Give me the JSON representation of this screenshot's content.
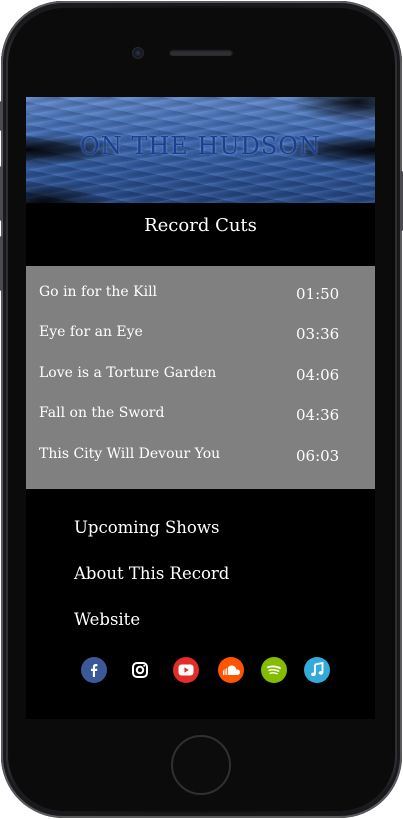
{
  "banner": {
    "title": "ON THE HUDSON"
  },
  "page": {
    "section_title": "Record Cuts"
  },
  "tracks": [
    {
      "title": "Go in for the Kill",
      "duration": "01:50"
    },
    {
      "title": "Eye for an Eye",
      "duration": "03:36"
    },
    {
      "title": "Love is a Torture Garden",
      "duration": "04:06"
    },
    {
      "title": "Fall on the Sword",
      "duration": "04:36"
    },
    {
      "title": "This City Will Devour You",
      "duration": "06:03"
    }
  ],
  "menu": {
    "items": [
      {
        "label": "Upcoming Shows"
      },
      {
        "label": "About This Record"
      },
      {
        "label": "Website"
      }
    ]
  },
  "social": {
    "icons": [
      {
        "name": "facebook-icon",
        "color": "#3b5998"
      },
      {
        "name": "instagram-icon",
        "color": "#000000"
      },
      {
        "name": "youtube-icon",
        "color": "#e52d27"
      },
      {
        "name": "soundcloud-icon",
        "color": "#ff5500"
      },
      {
        "name": "spotify-icon",
        "color": "#84bd00"
      },
      {
        "name": "apple-music-icon",
        "color": "#34aadc"
      }
    ]
  },
  "colors": {
    "screen_background": "#000000",
    "tracklist_background": "#808080",
    "text": "#ffffff"
  }
}
